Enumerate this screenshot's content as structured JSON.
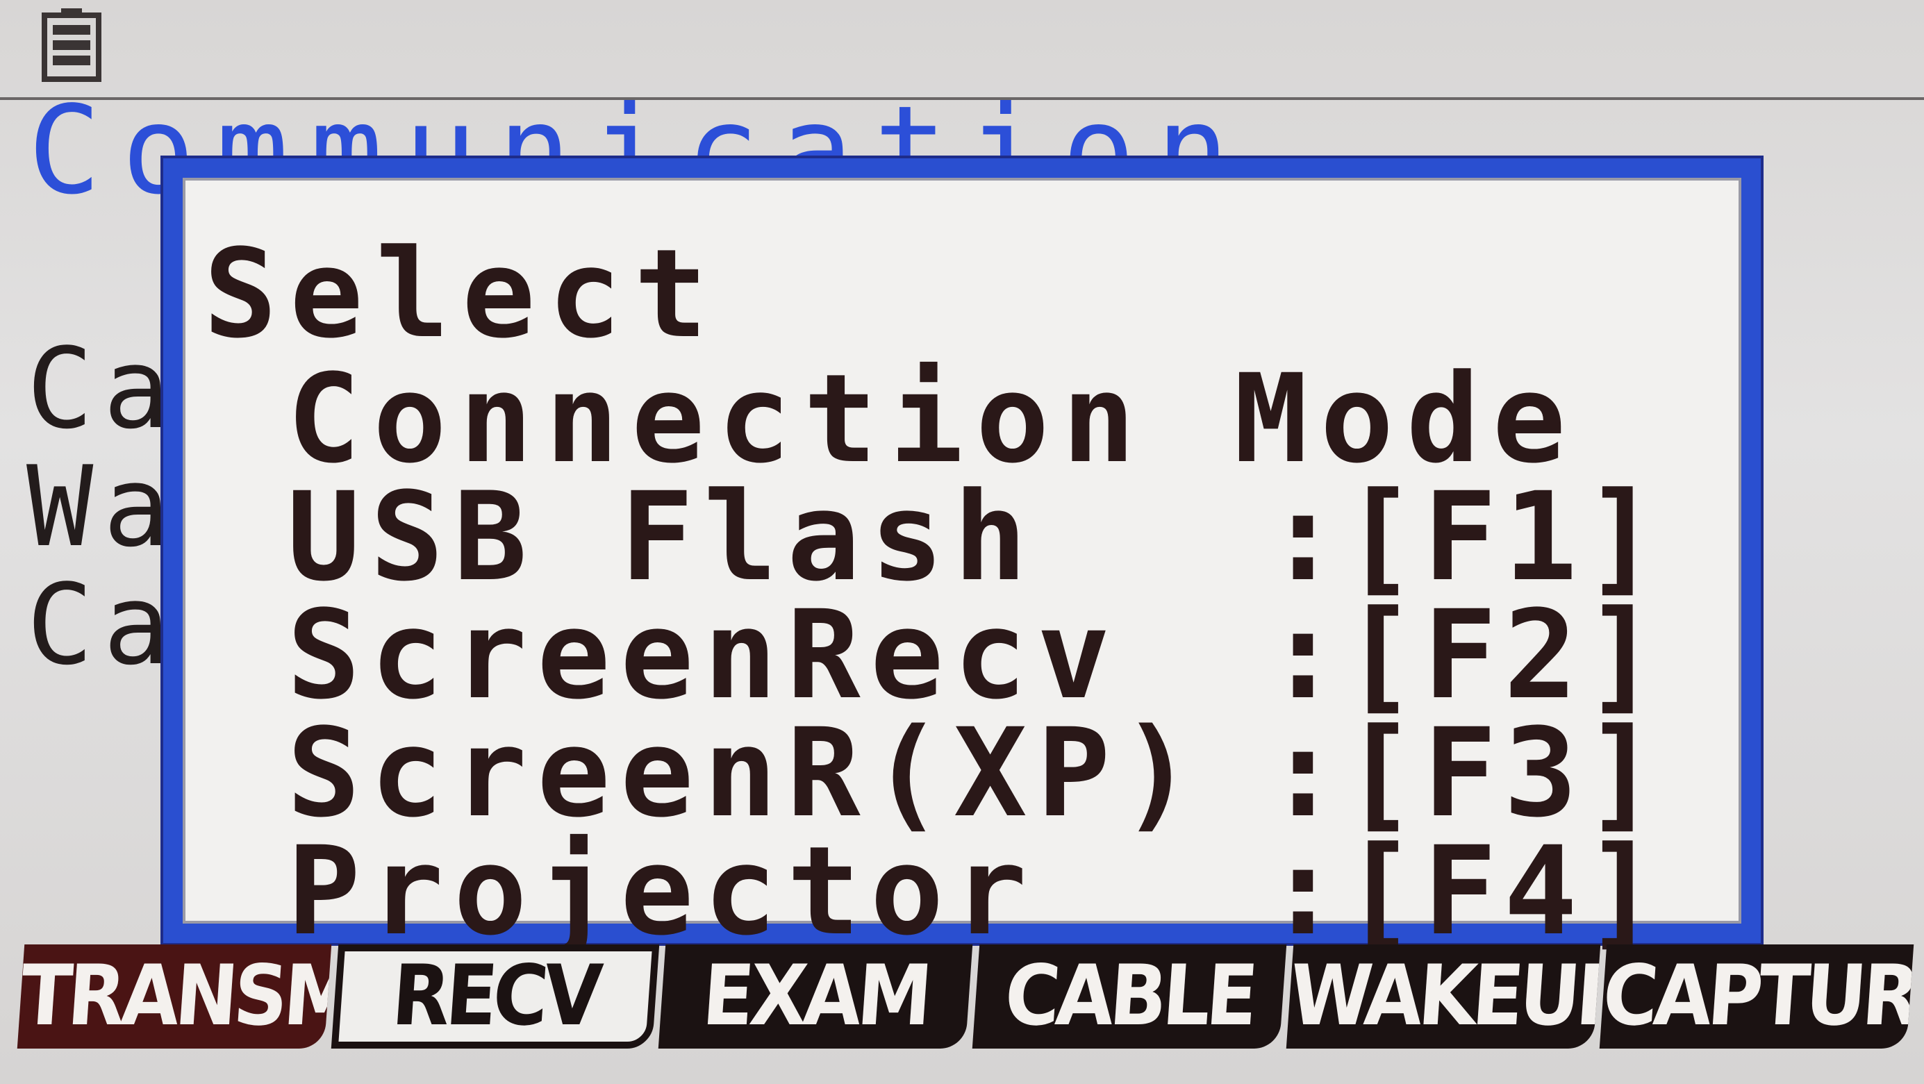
{
  "background": {
    "title": "Communication",
    "rows": [
      "Ca",
      "Wa",
      "Ca"
    ]
  },
  "dialog": {
    "title": "Select",
    "subtitle": "Connection Mode",
    "options": [
      {
        "label": "USB Flash",
        "key": "[F1]"
      },
      {
        "label": "ScreenRecv",
        "key": "[F2]"
      },
      {
        "label": "ScreenR(XP)",
        "key": "[F3]"
      },
      {
        "label": "Projector",
        "key": "[F4]"
      }
    ],
    "separator": ":"
  },
  "function_keys": [
    "TRANSMIT",
    "RECV",
    "EXAM",
    "CABLE",
    "WAKEUP",
    "CAPTURE"
  ],
  "colors": {
    "accent": "#2a4fd0",
    "title_blue": "#2c4fd8",
    "text": "#2a1818",
    "fkey_bg": "#1b1212"
  },
  "icons": {
    "status": "battery-icon"
  }
}
